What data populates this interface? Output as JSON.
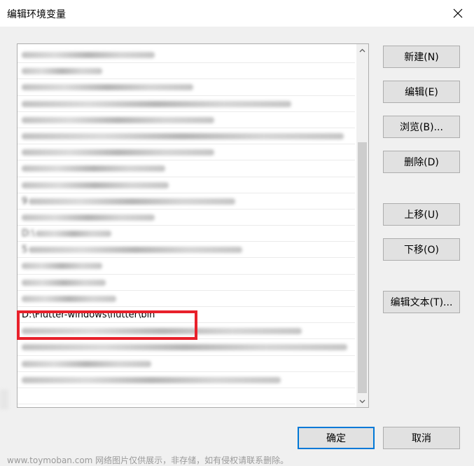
{
  "window": {
    "title": "编辑环境变量"
  },
  "list": {
    "highlighted_entry": "D:\\Flutter-windows\\flutter\\bin",
    "partial_entries": [
      "D:\\",
      "9",
      "5"
    ]
  },
  "buttons": {
    "new": "新建(N)",
    "edit": "编辑(E)",
    "browse": "浏览(B)...",
    "delete": "删除(D)",
    "move_up": "上移(U)",
    "move_down": "下移(O)",
    "edit_text": "编辑文本(T)...",
    "ok": "确定",
    "cancel": "取消"
  },
  "watermark": "www.toymoban.com 网络图片仅供展示，非存储，如有侵权请联系删除。",
  "colors": {
    "highlight_border": "#e8212b",
    "ok_border": "#0078d7"
  },
  "icons": {
    "close": "close-icon",
    "scroll_up": "chevron-up-icon",
    "scroll_down": "chevron-down-icon"
  }
}
